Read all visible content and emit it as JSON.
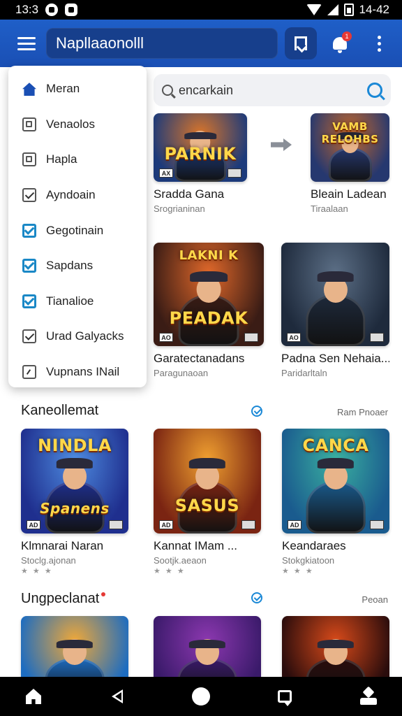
{
  "status_bar": {
    "time": "13:3",
    "right_text": "14-42"
  },
  "app_bar": {
    "title": "Napllaaonolll",
    "notification_count": "1"
  },
  "search": {
    "value": "encarkain",
    "placeholder": "encarkain"
  },
  "drawer": {
    "items": [
      {
        "label": "Meran",
        "icon": "home-icon"
      },
      {
        "label": "Venaolos",
        "icon": "document-icon"
      },
      {
        "label": "Hapla",
        "icon": "document-icon"
      },
      {
        "label": "Ayndoain",
        "icon": "checkbox-icon"
      },
      {
        "label": "Gegotinain",
        "icon": "checkbox-checked-icon"
      },
      {
        "label": "Sapdans",
        "icon": "checkbox-checked-icon"
      },
      {
        "label": "Tianalioe",
        "icon": "checkbox-checked-icon"
      },
      {
        "label": "Urad Galyacks",
        "icon": "checkbox-icon"
      },
      {
        "label": "Vupnans INail",
        "icon": "edit-icon"
      }
    ]
  },
  "featured": [
    {
      "title": "Sradda Gana",
      "subtitle": "Srogrianinan",
      "art_text": "PARNIK",
      "tag_left": "AX",
      "palette": [
        "#1c3a7a",
        "#d9752a"
      ]
    },
    {
      "title": "Bleain Ladean",
      "subtitle": "Tiraalaan",
      "art_text": "VAMB RELOHBS",
      "tag_left": "",
      "palette": [
        "#26386f",
        "#c8692a"
      ]
    },
    {
      "title": "Garatectanadans",
      "subtitle": "Paragunaoan",
      "art_text": "PEADAK",
      "art_text_top": "LAKNI K",
      "tag_left": "AO",
      "palette": [
        "#3a1c15",
        "#e0682a"
      ]
    },
    {
      "title": "Padna Sen Nehaia...",
      "subtitle": "Paridarltaln",
      "art_text": "",
      "tag_left": "AO",
      "palette": [
        "#1e2a3c",
        "#5c6f86"
      ]
    }
  ],
  "sections": [
    {
      "title": "Kaneollemat",
      "link": "Ram Pnoaer",
      "games": [
        {
          "title": "Klmnarai Naran",
          "subtitle": "Stoclg.ajonan",
          "art_text": "NINDLA",
          "art_text_bottom": "Spanens",
          "tag_left": "AD",
          "palette": [
            "#1f2f8e",
            "#4e8be0"
          ]
        },
        {
          "title": "Kannat IMam ...",
          "subtitle": "Sootjk.aeaon",
          "art_text": "SASUS",
          "tag_left": "AD",
          "palette": [
            "#7a2412",
            "#f0a030"
          ]
        },
        {
          "title": "Keandaraes",
          "subtitle": "Stokgkiatoon",
          "art_text": "CANCA",
          "tag_left": "AD",
          "palette": [
            "#1a5b8e",
            "#3ab0a0"
          ]
        }
      ]
    },
    {
      "title": "Ungpeclanat",
      "link": "Peoan",
      "games": [
        {
          "title": "",
          "subtitle": "",
          "art_text": "",
          "tag_left": "",
          "palette": [
            "#1d6cc0",
            "#f0a838"
          ]
        },
        {
          "title": "",
          "subtitle": "",
          "art_text": "",
          "tag_left": "",
          "palette": [
            "#3a1a6a",
            "#8c38b0"
          ]
        },
        {
          "title": "",
          "subtitle": "",
          "art_text": "",
          "tag_left": "",
          "palette": [
            "#2a0c0c",
            "#d84a1a"
          ]
        }
      ]
    }
  ],
  "bottom_nav": [
    "home-icon",
    "back-icon",
    "circle-home-icon",
    "chat-icon",
    "user-icon"
  ]
}
